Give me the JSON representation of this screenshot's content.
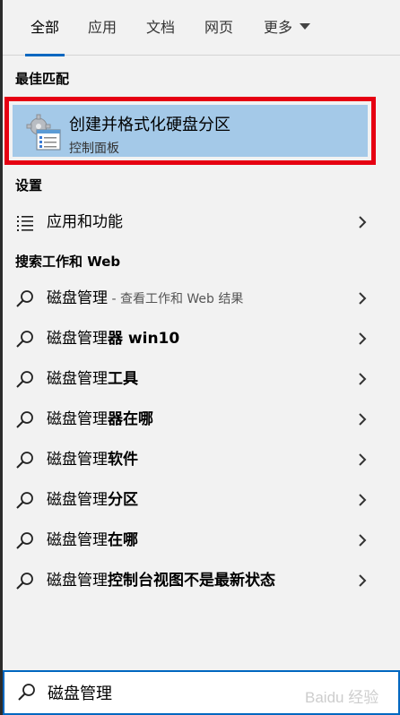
{
  "tabs": [
    {
      "label": "全部",
      "active": true
    },
    {
      "label": "应用"
    },
    {
      "label": "文档"
    },
    {
      "label": "网页"
    },
    {
      "label": "更多"
    }
  ],
  "sections": {
    "best_match": "最佳匹配",
    "settings": "设置",
    "search_web": "搜索工作和 Web"
  },
  "best_match": {
    "title": "创建并格式化硬盘分区",
    "subtitle": "控制面板",
    "icon": "control-panel-icon",
    "highlight_color": "#e60012",
    "bg_color": "#a4c9e8"
  },
  "settings_items": [
    {
      "label": "应用和功能",
      "icon": "list-icon"
    }
  ],
  "web_items": [
    {
      "base": "磁盘管理",
      "bold": "",
      "suffix": " - 查看工作和 Web 结果"
    },
    {
      "base": "磁盘管理",
      "bold": "器 win10",
      "suffix": ""
    },
    {
      "base": "磁盘管理",
      "bold": "工具",
      "suffix": ""
    },
    {
      "base": "磁盘管理",
      "bold": "器在哪",
      "suffix": ""
    },
    {
      "base": "磁盘管理",
      "bold": "软件",
      "suffix": ""
    },
    {
      "base": "磁盘管理",
      "bold": "分区",
      "suffix": ""
    },
    {
      "base": "磁盘管理",
      "bold": "在哪",
      "suffix": ""
    },
    {
      "base": "磁盘管理",
      "bold": "控制台视图不是最新状态",
      "suffix": ""
    }
  ],
  "search": {
    "value": "磁盘管理",
    "icon": "search-icon"
  },
  "watermark": "Baidu 经验",
  "colors": {
    "accent": "#0067c0",
    "background": "#f2f2f2"
  }
}
